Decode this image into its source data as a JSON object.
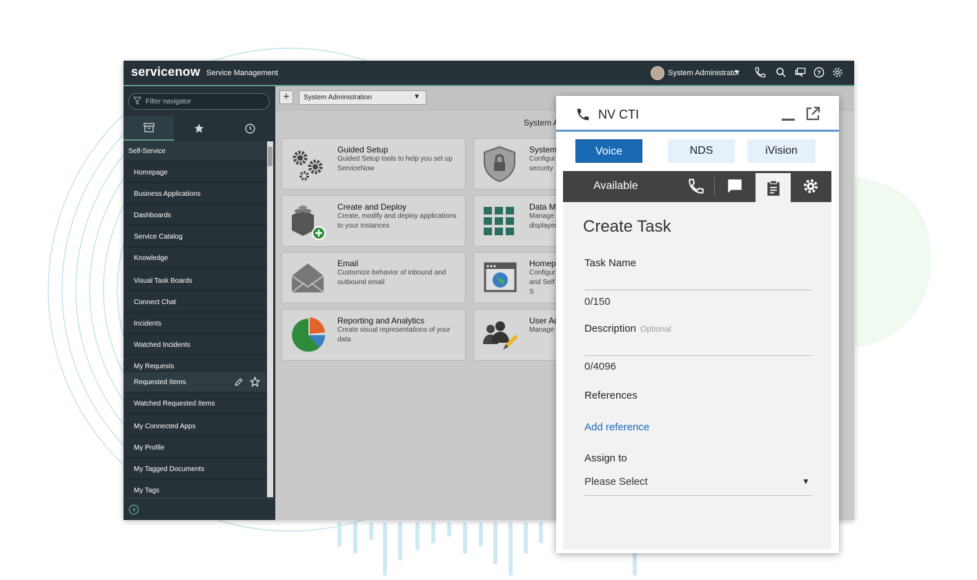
{
  "header": {
    "logo": "servicenow",
    "product": "Service Management",
    "user_name": "System Administrator"
  },
  "sidebar": {
    "filter_placeholder": "Filter navigator",
    "section": "Self-Service",
    "items": [
      {
        "label": "Homepage"
      },
      {
        "label": "Business Applications"
      },
      {
        "label": "Dashboards"
      },
      {
        "label": "Service Catalog"
      },
      {
        "label": "Knowledge"
      },
      {
        "label": "Visual Task Boards"
      },
      {
        "label": "Connect Chat"
      },
      {
        "label": "Incidents"
      },
      {
        "label": "Watched Incidents"
      },
      {
        "label": "My Requests"
      },
      {
        "label": "Requested Items"
      },
      {
        "label": "Watched Requested Items"
      },
      {
        "label": "My Connected Apps"
      },
      {
        "label": "My Profile"
      },
      {
        "label": "My Tagged Documents"
      },
      {
        "label": "My Tags"
      }
    ]
  },
  "content": {
    "plus_label": "+",
    "dashboard_select": "System Administration",
    "title": "System A",
    "cards": [
      {
        "title": "Guided Setup",
        "desc": "Guided Setup tools to help you set up ServiceNow"
      },
      {
        "title": "System",
        "desc": "Configur security"
      },
      {
        "title": "Create and Deploy",
        "desc": "Create, modify and deploy applications to your instances"
      },
      {
        "title": "Data Ma",
        "desc": "Manage t displayed"
      },
      {
        "title": "Email",
        "desc": "Customize behavior of inbound and outbound email"
      },
      {
        "title": "Homepa",
        "desc": "Configur and Self S"
      },
      {
        "title": "Reporting and Analytics",
        "desc": "Create visual representations of your data"
      },
      {
        "title": "User Ad",
        "desc": "Manage u"
      }
    ]
  },
  "cti": {
    "title": "NV CTI",
    "tabs": [
      "Voice",
      "NDS",
      "iVision"
    ],
    "status": "Available",
    "form": {
      "title": "Create Task",
      "task_name_label": "Task Name",
      "task_name_counter": "0/150",
      "description_label": "Description",
      "description_optional": "Optional",
      "description_counter": "0/4096",
      "references_label": "References",
      "add_reference": "Add reference",
      "assign_label": "Assign to",
      "assign_value": "Please Select"
    }
  },
  "colors": {
    "topbar": "#263238",
    "accent_green": "#5b9a8c",
    "voice_blue": "#1a69b3",
    "tab_light": "#e4f0fa",
    "status_bar": "#424242"
  }
}
